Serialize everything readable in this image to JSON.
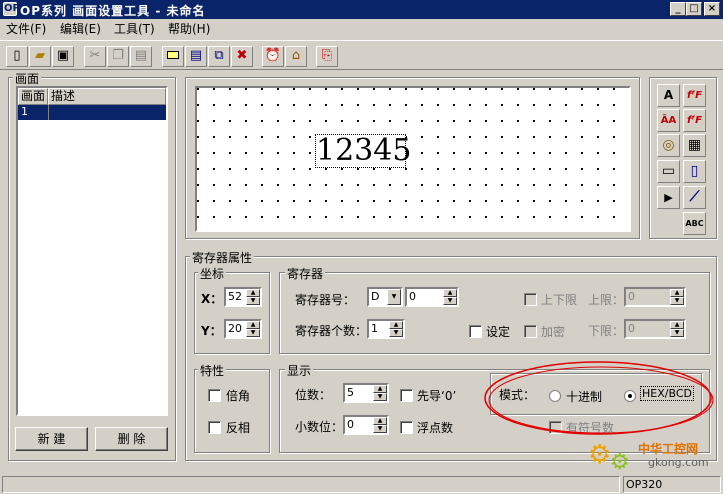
{
  "window": {
    "title": "OP系列 画面设置工具 - 未命名",
    "logo": "OP",
    "min": "_",
    "max": "□",
    "close": "×"
  },
  "menu": [
    "文件(F)",
    "编辑(E)",
    "工具(T)",
    "帮助(H)"
  ],
  "toolbar_icons": [
    "new-file-icon",
    "open-folder-icon",
    "save-icon",
    "cut-icon",
    "copy-icon",
    "paste-icon",
    "screen-icon",
    "screen-properties-icon",
    "screen-copy-icon",
    "screen-delete-icon",
    "alarm-clock-icon",
    "home-icon",
    "export-icon"
  ],
  "screen_panel": {
    "title": "画面",
    "columns": [
      "画面",
      "描述"
    ],
    "rows": [
      {
        "num": "1",
        "desc": ""
      }
    ],
    "new_button": "新 建",
    "delete_button": "删 除"
  },
  "preview": {
    "number_text": "12345"
  },
  "right_tools": [
    {
      "name": "text-tool",
      "glyph": "A"
    },
    {
      "name": "font-tool",
      "glyph": "fᶠF"
    },
    {
      "name": "ascii-text-tool",
      "glyph": "ÂA"
    },
    {
      "name": "font-size-tool",
      "glyph": "fᶠF"
    },
    {
      "name": "lamp-tool",
      "glyph": "◎"
    },
    {
      "name": "bitmap-tool",
      "glyph": "▦"
    },
    {
      "name": "register-tool",
      "glyph": "▭"
    },
    {
      "name": "bar-tool",
      "glyph": "▯"
    },
    {
      "name": "button-tool",
      "glyph": "▶"
    },
    {
      "name": "trend-tool",
      "glyph": "⟋"
    },
    {
      "name": "abc-tool",
      "glyph": "ABC"
    }
  ],
  "props": {
    "title": "寄存器属性",
    "coords": {
      "title": "坐标",
      "x_label": "X：",
      "x": "52",
      "y_label": "Y：",
      "y": "20"
    },
    "register": {
      "title": "寄存器",
      "addr_label": "寄存器号：",
      "type": "D",
      "addr": "0",
      "count_label": "寄存器个数：",
      "count": "1",
      "limits_label": "上下限",
      "upper_label": "上限：",
      "upper": "0",
      "lower_label": "下限：",
      "lower": "0",
      "set_label": "设定",
      "encrypt_label": "加密"
    },
    "feature": {
      "title": "特性",
      "double_label": "倍角",
      "invert_label": "反相"
    },
    "display": {
      "title": "显示",
      "digits_label": "位数：",
      "digits": "5",
      "leading_zero_label": "先导‘0’",
      "decimals_label": "小数位：",
      "decimals": "0",
      "float_label": "浮点数",
      "mode_label": "模式：",
      "decimal_mode": "十进制",
      "hex_mode": "HEX/BCD",
      "signed_label": "有符号数"
    }
  },
  "status": {
    "left": "",
    "right": "OP320"
  },
  "watermark": {
    "text": "中华工控网",
    "url": "gkong.com"
  }
}
